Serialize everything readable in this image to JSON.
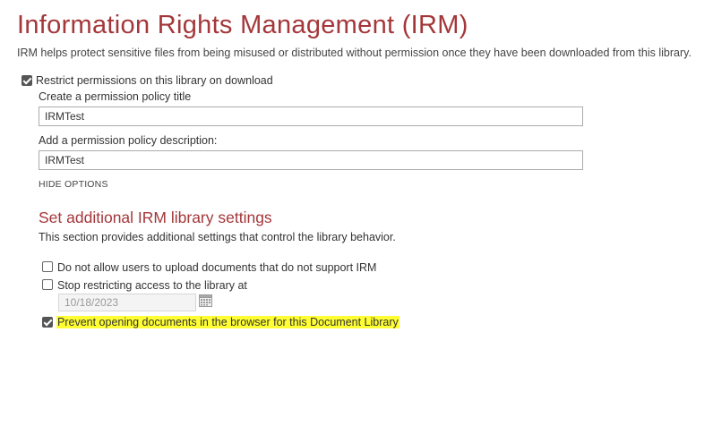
{
  "header": {
    "title": "Information Rights Management (IRM)",
    "description": "IRM helps protect sensitive files from being misused or distributed without permission once they have been downloaded from this library."
  },
  "restrict": {
    "checked": true,
    "label": "Restrict permissions on this library on download"
  },
  "policy_title": {
    "label": "Create a permission policy title",
    "value": "IRMTest"
  },
  "policy_description": {
    "label": "Add a permission policy description:",
    "value": "IRMTest"
  },
  "hide_options_label": "HIDE OPTIONS",
  "additional": {
    "title": "Set additional IRM library settings",
    "description": "This section provides additional settings that control the library behavior.",
    "options": [
      {
        "label": "Do not allow users to upload documents that do not support IRM",
        "checked": false
      },
      {
        "label": "Stop restricting access to the library at",
        "checked": false,
        "date_value": "10/18/2023"
      },
      {
        "label": "Prevent opening documents in the browser for this Document Library",
        "checked": true,
        "highlighted": true
      }
    ]
  },
  "icons": {
    "calendar": "calendar-icon"
  },
  "colors": {
    "title": "#a4373a",
    "highlight": "#ffff33"
  }
}
